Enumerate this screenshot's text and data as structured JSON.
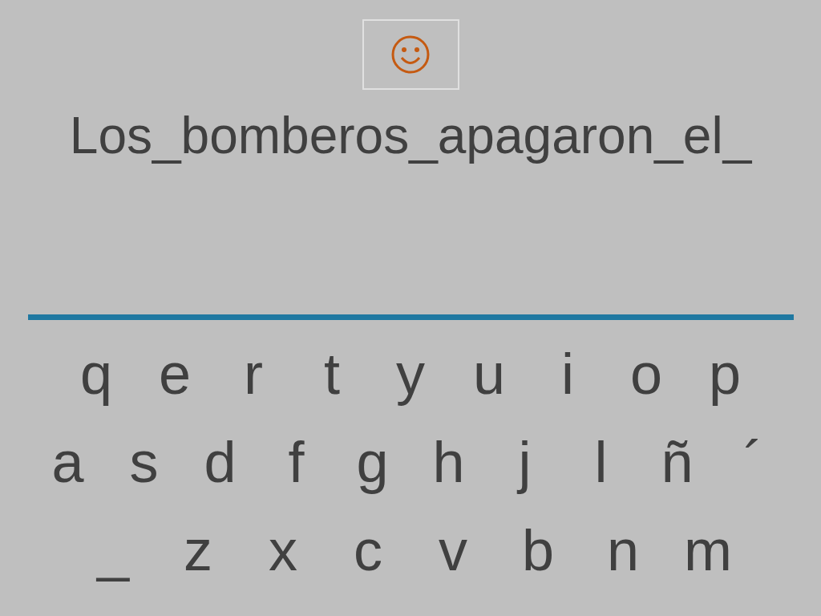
{
  "sentence": "Los_bomberos_apagaron_el_",
  "keyboard": {
    "rows": [
      {
        "keys": [
          "q",
          "e",
          "r",
          "t",
          "y",
          "u",
          "i",
          "o",
          "p"
        ]
      },
      {
        "keys": [
          "a",
          "s",
          "d",
          "f",
          "g",
          "h",
          "j",
          "l",
          "ñ",
          "´"
        ]
      },
      {
        "keys": [
          "_",
          "z",
          "x",
          "c",
          "v",
          "b",
          "n",
          "m"
        ]
      }
    ]
  }
}
